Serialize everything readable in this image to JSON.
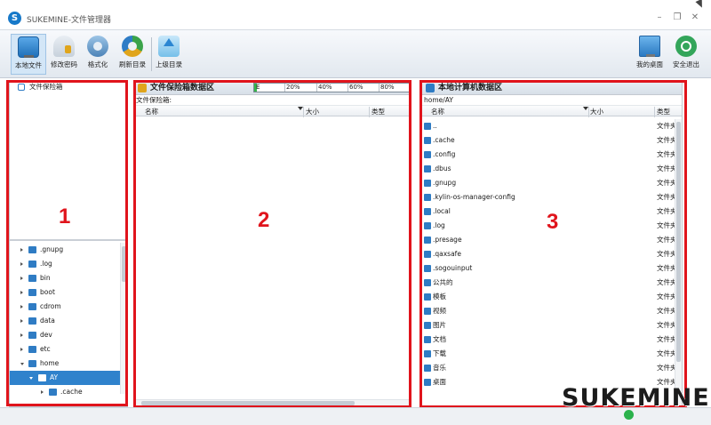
{
  "window": {
    "logo_letter": "S",
    "title": "SUKEMINE-文件管理器",
    "minimize": "–",
    "restore": "❐",
    "close": "✕"
  },
  "toolbar": {
    "local_files": "本地文件",
    "change_password": "修改密码",
    "format": "格式化",
    "refresh_dir": "刷新目录",
    "parent_dir": "上级目录",
    "my_desktop": "我的桌面",
    "safe_exit": "安全退出"
  },
  "left_panel": {
    "vault_label": "文件保险箱",
    "tree": [
      {
        "label": ".gnupg"
      },
      {
        "label": ".log"
      },
      {
        "label": "bin"
      },
      {
        "label": "boot"
      },
      {
        "label": "cdrom"
      },
      {
        "label": "data"
      },
      {
        "label": "dev"
      },
      {
        "label": "etc"
      },
      {
        "label": "home"
      },
      {
        "label": "AY"
      },
      {
        "label": ".cache"
      }
    ]
  },
  "vault_panel": {
    "title": "文件保险箱数据区",
    "progress": {
      "fraction": 0.02,
      "start_label": "E",
      "labels": [
        "20%",
        "40%",
        "60%",
        "80%"
      ]
    },
    "path": "文件保险箱:",
    "columns": {
      "name": "名称",
      "size": "大小",
      "type": "类型"
    }
  },
  "local_panel": {
    "title": "本地计算机数据区",
    "path": "home/AY",
    "columns": {
      "name": "名称",
      "size": "大小",
      "type": "类型"
    },
    "rows": [
      {
        "name": "..",
        "type": "文件夹"
      },
      {
        "name": ".cache",
        "type": "文件夹"
      },
      {
        "name": ".config",
        "type": "文件夹"
      },
      {
        "name": ".dbus",
        "type": "文件夹"
      },
      {
        "name": ".gnupg",
        "type": "文件夹"
      },
      {
        "name": ".kylin-os-manager-config",
        "type": "文件夹"
      },
      {
        "name": ".local",
        "type": "文件夹"
      },
      {
        "name": ".log",
        "type": "文件夹"
      },
      {
        "name": ".presage",
        "type": "文件夹"
      },
      {
        "name": ".qaxsafe",
        "type": "文件夹"
      },
      {
        "name": ".sogouinput",
        "type": "文件夹"
      },
      {
        "name": "公共的",
        "type": "文件夹"
      },
      {
        "name": "模板",
        "type": "文件夹"
      },
      {
        "name": "视频",
        "type": "文件夹"
      },
      {
        "name": "图片",
        "type": "文件夹"
      },
      {
        "name": "文档",
        "type": "文件夹"
      },
      {
        "name": "下载",
        "type": "文件夹"
      },
      {
        "name": "音乐",
        "type": "文件夹"
      },
      {
        "name": "桌面",
        "type": "文件夹"
      }
    ]
  },
  "annotations": {
    "one": "1",
    "two": "2",
    "three": "3"
  },
  "watermark": "SUKEMINE",
  "colors": {
    "accent": "#2f82cc",
    "annotation_red": "#e0141c",
    "status_green": "#2bb24c"
  }
}
